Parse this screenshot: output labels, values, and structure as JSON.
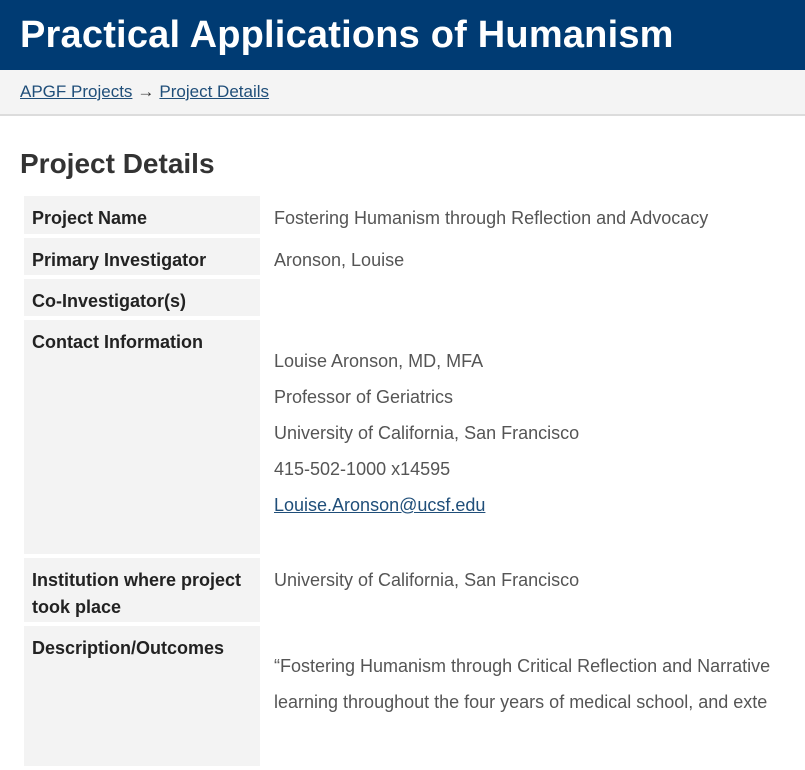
{
  "header": {
    "title": "Practical Applications of Humanism"
  },
  "breadcrumb": {
    "items": [
      "APGF Projects",
      "Project Details"
    ],
    "separator": "→"
  },
  "main": {
    "heading": "Project Details",
    "rows": [
      {
        "label": "Project Name",
        "value": "Fostering Humanism through Reflection and Advocacy"
      },
      {
        "label": "Primary Investigator",
        "value": "Aronson, Louise"
      },
      {
        "label": "Co-Investigator(s)",
        "value": ""
      },
      {
        "label": "Contact Information"
      },
      {
        "label": "Institution where project took place",
        "value": "University of California, San Francisco"
      },
      {
        "label": "Description/Outcomes"
      }
    ],
    "contact": {
      "name": "Louise Aronson, MD, MFA",
      "title": "Professor of Geriatrics",
      "institution": "University of California, San Francisco",
      "phone": "415-502-1000 x14595",
      "email": "Louise.Aronson@ucsf.edu"
    },
    "description": {
      "line1": "“Fostering Humanism through Critical Reflection and Narrative",
      "line2": "learning throughout the four years of medical school, and exte"
    }
  },
  "colors": {
    "banner": "#003b73",
    "link": "#1f4e79",
    "label_bg": "#f3f3f3"
  }
}
